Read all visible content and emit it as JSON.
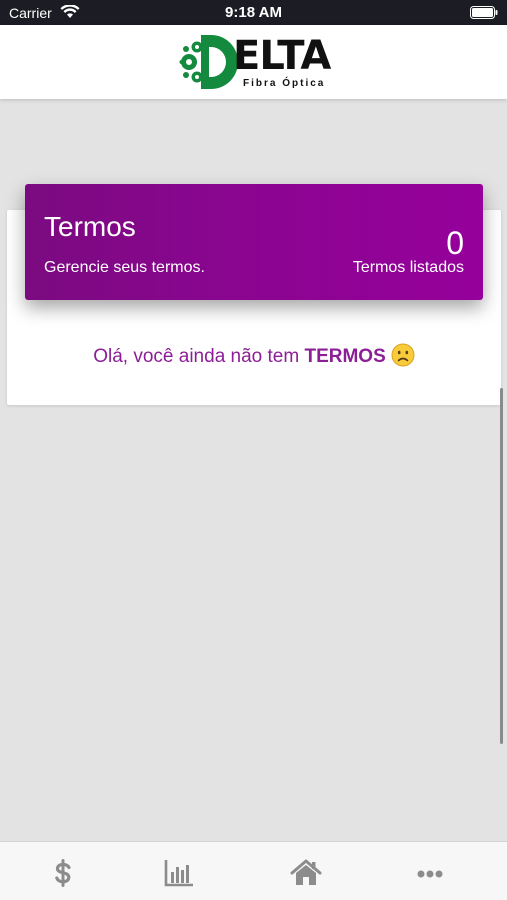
{
  "status_bar": {
    "carrier": "Carrier",
    "time": "9:18 AM"
  },
  "header": {
    "logo_word": "ELTA",
    "logo_subtitle": "Fibra Óptica",
    "logo_color": "#138a3e"
  },
  "termos_card": {
    "title": "Termos",
    "subtitle": "Gerencie seus termos.",
    "count": "0",
    "count_label": "Termos listados",
    "gradient_start": "#7b0a80",
    "gradient_end": "#96009b"
  },
  "empty_state": {
    "text": "Olá, você ainda não tem ",
    "highlight": "TERMOS",
    "icon": "sad-face-icon"
  },
  "tab_bar": {
    "items": [
      {
        "icon": "dollar-icon"
      },
      {
        "icon": "bar-chart-icon"
      },
      {
        "icon": "home-icon"
      },
      {
        "icon": "more-icon"
      }
    ]
  }
}
